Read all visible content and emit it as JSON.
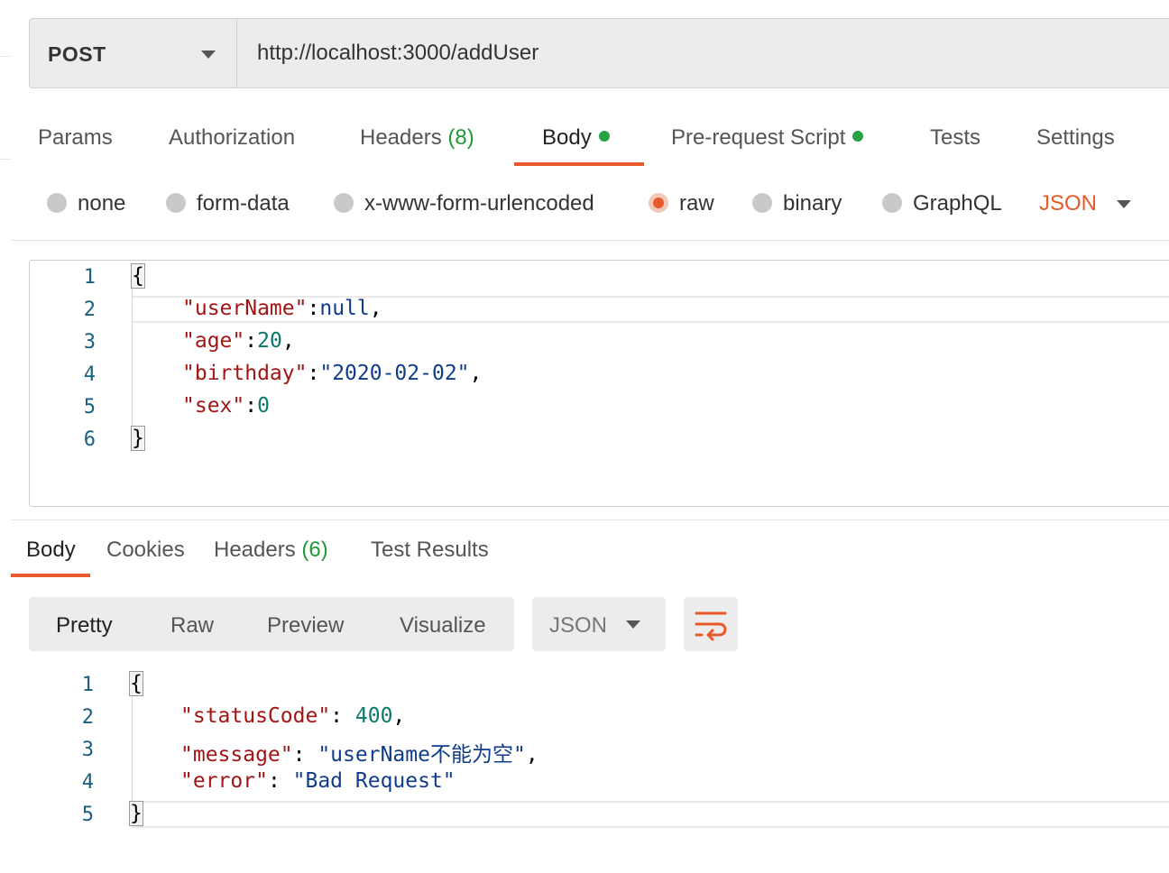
{
  "request": {
    "method": "POST",
    "url": "http://localhost:3000/addUser"
  },
  "request_tabs": [
    {
      "label": "Params"
    },
    {
      "label": "Authorization"
    },
    {
      "label": "Headers",
      "count": "(8)"
    },
    {
      "label": "Body",
      "active": true,
      "dot": true
    },
    {
      "label": "Pre-request Script",
      "dot": true
    },
    {
      "label": "Tests"
    },
    {
      "label": "Settings"
    }
  ],
  "body_types": {
    "options": [
      "none",
      "form-data",
      "x-www-form-urlencoded",
      "raw",
      "binary",
      "GraphQL"
    ],
    "selected": "raw",
    "format": "JSON"
  },
  "request_body": {
    "line_numbers": [
      "1",
      "2",
      "3",
      "4",
      "5",
      "6"
    ],
    "lines": [
      {
        "text": "{"
      },
      {
        "key": "\"userName\"",
        "value": "null",
        "trail": ","
      },
      {
        "key": "\"age\"",
        "value": "20",
        "trail": ","
      },
      {
        "key": "\"birthday\"",
        "value": "\"2020-02-02\"",
        "trail": ","
      },
      {
        "key": "\"sex\"",
        "value": "0",
        "trail": ""
      },
      {
        "text": "}"
      }
    ]
  },
  "response_tabs": [
    {
      "label": "Body",
      "active": true
    },
    {
      "label": "Cookies"
    },
    {
      "label": "Headers",
      "count": "(6)"
    },
    {
      "label": "Test Results"
    }
  ],
  "response_view": {
    "modes": [
      "Pretty",
      "Raw",
      "Preview",
      "Visualize"
    ],
    "active": "Pretty",
    "format": "JSON"
  },
  "response_body": {
    "line_numbers": [
      "1",
      "2",
      "3",
      "4",
      "5"
    ],
    "lines": [
      {
        "text": "{"
      },
      {
        "key": "\"statusCode\"",
        "value": "400",
        "trail": ","
      },
      {
        "key": "\"message\"",
        "value": "\"userName不能为空\"",
        "trail": ","
      },
      {
        "key": "\"error\"",
        "value": "\"Bad Request\"",
        "trail": ""
      },
      {
        "text": "}"
      }
    ]
  },
  "colors": {
    "accent": "#e8592b",
    "status_green": "#27a243",
    "json_key": "#a31515",
    "json_string": "#0f3d8c",
    "json_number": "#097969"
  }
}
